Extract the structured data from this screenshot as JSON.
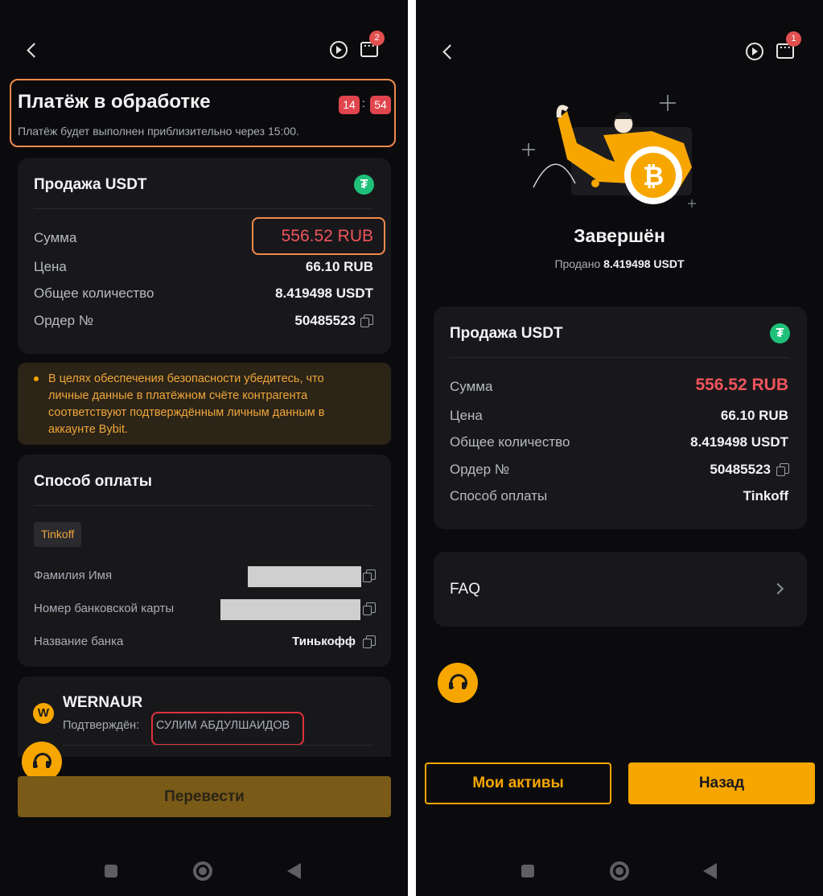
{
  "left_screen": {
    "chat_badge": "2",
    "status": {
      "title": "Платёж в обработке",
      "timer_min": "14",
      "timer_sep": ":",
      "timer_sec": "54",
      "subtitle": "Платёж будет выполнен приблизительно через 15:00."
    },
    "order_card": {
      "title": "Продажа USDT",
      "coin_symbol": "₮",
      "rows": [
        {
          "label": "Сумма",
          "value": "556.52 RUB"
        },
        {
          "label": "Цена",
          "value": "66.10 RUB"
        },
        {
          "label": "Общее количество",
          "value": "8.419498 USDT"
        },
        {
          "label": "Ордер №",
          "value": "50485523"
        }
      ]
    },
    "notice": "В целях обеспечения безопасности убедитесь, что личные данные в платёжном счёте контрагента соответствуют подтверждённым личным данным в аккаунте Bybit.",
    "payment_card": {
      "title": "Способ оплаты",
      "method_tag": "Tinkoff",
      "rows": [
        {
          "label": "Фамилия Имя",
          "value": ""
        },
        {
          "label": "Номер банковской карты",
          "value": ""
        },
        {
          "label": "Название банка",
          "value": "Тинькофф"
        }
      ]
    },
    "merchant": {
      "avatar_letter": "W",
      "name": "WERNAUR",
      "verified_label": "Подтверждён:",
      "verified_name": "СУЛИМ АБДУЛШАИДОВ"
    },
    "transfer_button": "Перевести"
  },
  "right_screen": {
    "chat_badge": "1",
    "status_title": "Завершён",
    "sold_label": "Продано",
    "sold_value": "8.419498 USDT",
    "order_card": {
      "title": "Продажа USDT",
      "coin_symbol": "₮",
      "rows": [
        {
          "label": "Сумма",
          "value": "556.52 RUB"
        },
        {
          "label": "Цена",
          "value": "66.10 RUB"
        },
        {
          "label": "Общее количество",
          "value": "8.419498 USDT"
        },
        {
          "label": "Ордер №",
          "value": "50485523"
        },
        {
          "label": "Способ оплаты",
          "value": "Tinkoff"
        }
      ]
    },
    "faq_label": "FAQ",
    "assets_button": "Мои активы",
    "back_button": "Назад"
  },
  "colors": {
    "accent": "#f7a600",
    "amount_red": "#f0545c",
    "highlight_orange": "#f08a4b",
    "highlight_red": "#e0303a",
    "background": "#0b0b0d",
    "card": "#18181b"
  }
}
